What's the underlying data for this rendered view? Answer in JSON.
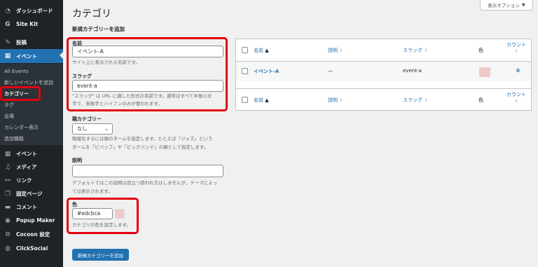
{
  "sidebar": {
    "dashboard": "ダッシュボード",
    "sitekit": "Site Kit",
    "posts": "投稿",
    "events_active": "イベント",
    "submenu": {
      "all_events": "All Events",
      "add_new_event": "新しいイベントを追加",
      "categories": "カテゴリー",
      "tags": "タグ",
      "venues": "会場",
      "calendar": "カレンダー表示",
      "addons": "追加機能"
    },
    "events2": "イベント",
    "media": "メディア",
    "links": "リンク",
    "pages": "固定ページ",
    "comments": "コメント",
    "popup_maker": "Popup Maker",
    "cocoon": "Cocoon 設定",
    "clicksocial": "ClickSocial",
    "accent_color": "#2271b1"
  },
  "header": {
    "title": "カテゴリ",
    "screen_options": "表示オプション",
    "screen_options_arrow": "▼"
  },
  "form": {
    "heading": "新規カテゴリーを追加",
    "name_label": "名前",
    "name_value": "イベント-A",
    "name_desc": "サイト上に表示される名前です。",
    "slug_label": "スラッグ",
    "slug_value": "event-a",
    "slug_desc_1": "\"スラッグ\" は URL に適した形式の名前です。通常はすべて半角小文",
    "slug_desc_2": "字で、英数字とハイフンのみが使われます。",
    "parent_label": "親カテゴリー",
    "parent_value": "なし",
    "parent_desc_1": "階層化するには親のタームを指定します。たとえば「ジャズ」という",
    "parent_desc_2": "タームを「ビバップ」や「ビッグバンド」の親として指定します。",
    "description_label": "説明",
    "description_desc_1": "デフォルトではこの説明は目立つ使われ方はしませんが、テーマによっ",
    "description_desc_2": "ては表示されます。",
    "color_label": "色",
    "color_value": "#edcbca",
    "color_desc": "カテゴリの色を設定します。",
    "submit_label": "新規カテゴリーを追加",
    "highlight_color": "#e3000f"
  },
  "table": {
    "columns": {
      "name": "名前",
      "description": "説明",
      "slug": "スラッグ",
      "color": "色",
      "count": "カウント"
    },
    "rows": [
      {
        "name": "イベント-A",
        "description": "—",
        "slug": "event-a",
        "color": "#edcbca",
        "count": "0"
      }
    ]
  }
}
